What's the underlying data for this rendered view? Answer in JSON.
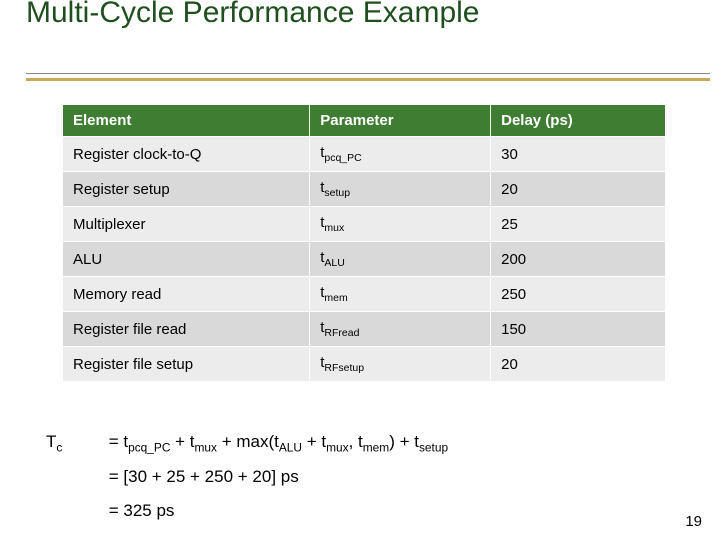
{
  "title": "Multi-Cycle Performance Example",
  "table": {
    "headers": {
      "element": "Element",
      "parameter": "Parameter",
      "delay": "Delay (ps)"
    },
    "rows": [
      {
        "element": "Register clock-to-Q",
        "param_base": "t",
        "param_sub": "pcq_PC",
        "delay": "30"
      },
      {
        "element": "Register setup",
        "param_base": "t",
        "param_sub": "setup",
        "delay": "20"
      },
      {
        "element": "Multiplexer",
        "param_base": "t",
        "param_sub": "mux",
        "delay": "25"
      },
      {
        "element": "ALU",
        "param_base": "t",
        "param_sub": "ALU",
        "delay": "200"
      },
      {
        "element": "Memory read",
        "param_base": "t",
        "param_sub": "mem",
        "delay": "250"
      },
      {
        "element": "Register file read",
        "param_base": "t",
        "param_sub": "RFread",
        "delay": "150"
      },
      {
        "element": "Register file setup",
        "param_base": "t",
        "param_sub": "RFsetup",
        "delay": "20"
      }
    ]
  },
  "equation": {
    "lhs_base": "T",
    "lhs_sub": "c",
    "line2": "= [30 + 25 + 250 + 20] ps",
    "line3": "= 325 ps"
  },
  "chart_data": {
    "type": "table",
    "title": "Multi-Cycle Performance Example",
    "columns": [
      "Element",
      "Parameter",
      "Delay (ps)"
    ],
    "rows": [
      [
        "Register clock-to-Q",
        "t_pcq_PC",
        30
      ],
      [
        "Register setup",
        "t_setup",
        20
      ],
      [
        "Multiplexer",
        "t_mux",
        25
      ],
      [
        "ALU",
        "t_ALU",
        200
      ],
      [
        "Memory read",
        "t_mem",
        250
      ],
      [
        "Register file read",
        "t_RFread",
        150
      ],
      [
        "Register file setup",
        "t_RFsetup",
        20
      ]
    ],
    "derived": {
      "formula": "T_c = t_pcq_PC + t_mux + max(t_ALU + t_mux, t_mem) + t_setup",
      "substituted": "[30 + 25 + 250 + 20] ps",
      "result_ps": 325
    }
  },
  "page_number": "19"
}
